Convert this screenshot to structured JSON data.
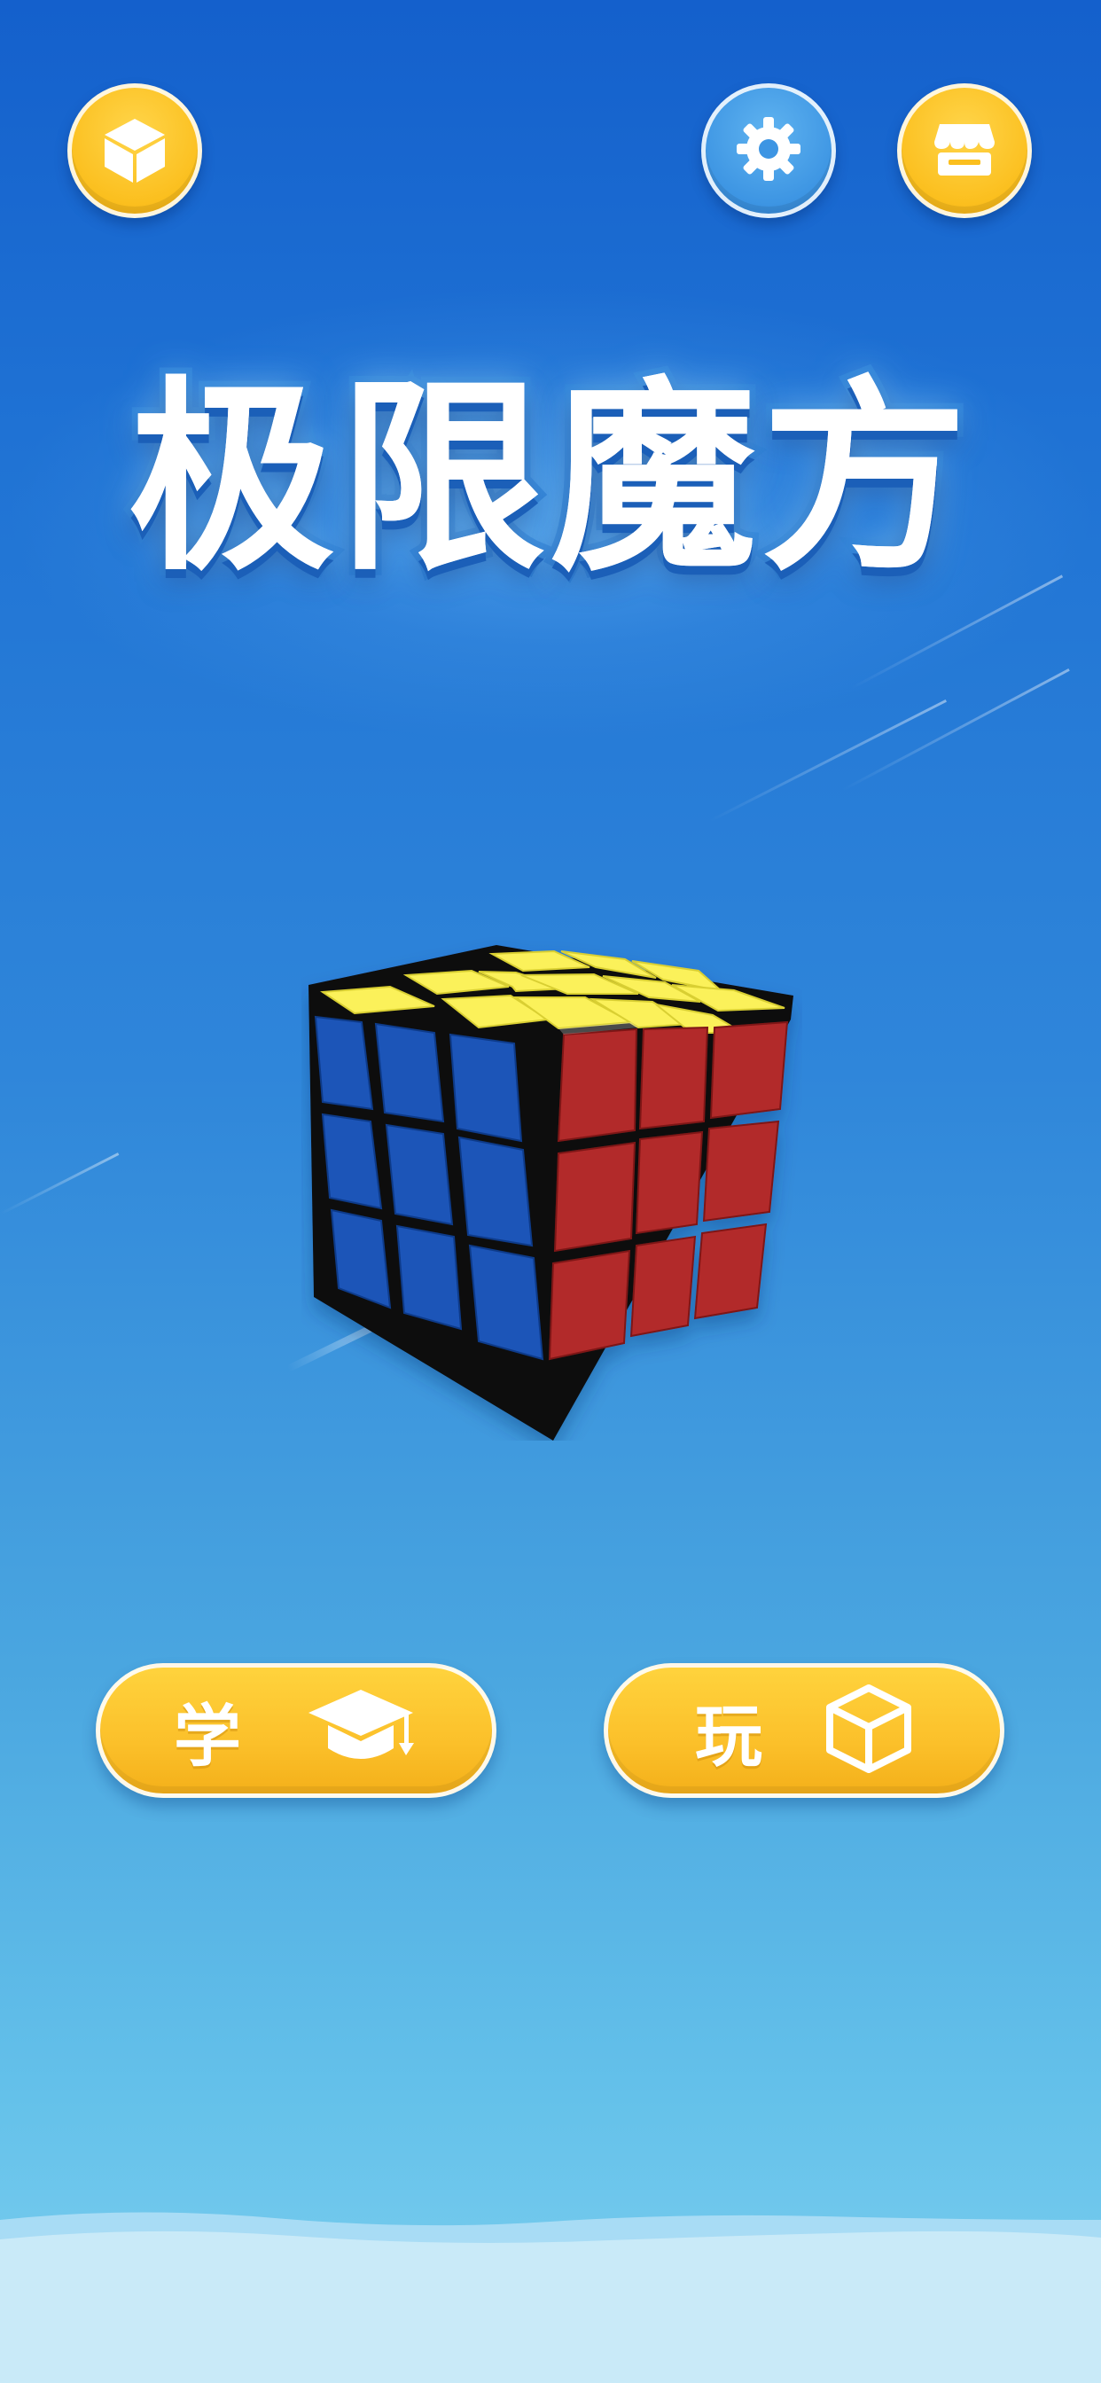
{
  "app": {
    "title": "极限魔方"
  },
  "top_bar": {
    "left_button_icon": "cube-icon",
    "settings_button_icon": "gear-icon",
    "shop_button_icon": "shop-icon"
  },
  "actions": {
    "learn_label": "学",
    "learn_icon": "graduation-cap-icon",
    "play_label": "玩",
    "play_icon": "cube-outline-icon"
  },
  "colors": {
    "accent_yellow": "#FBC02A",
    "settings_blue": "#3D95E3",
    "background_top": "#1460CC",
    "background_bottom": "#7FD0EF",
    "cube_yellow": "#FBF15A",
    "cube_blue": "#1D55B8",
    "cube_red": "#B22A2A"
  }
}
